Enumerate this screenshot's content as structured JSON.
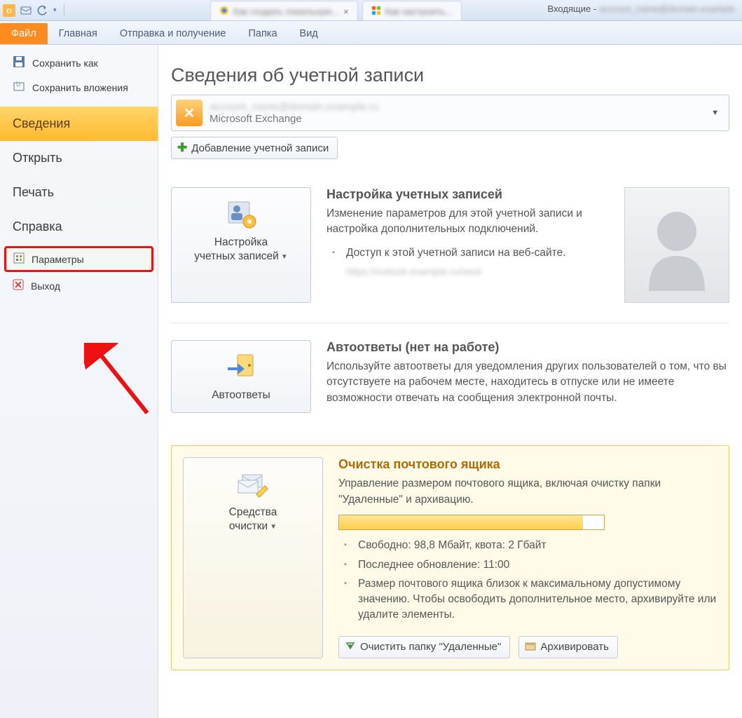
{
  "titlebar": {
    "title_prefix": "Входящие - ",
    "browser_tab1": "Как создать локальную...",
    "browser_tab2": "Как настроить..."
  },
  "ribbon": {
    "file": "Файл",
    "home": "Главная",
    "sendreceive": "Отправка и получение",
    "folder": "Папка",
    "view": "Вид"
  },
  "backstage": {
    "saveas": "Сохранить как",
    "saveattach": "Сохранить вложения",
    "info": "Сведения",
    "open": "Открыть",
    "print": "Печать",
    "help": "Справка",
    "options": "Параметры",
    "exit": "Выход"
  },
  "account": {
    "heading": "Сведения об учетной записи",
    "email_blurred": "account_name@domain.example.ru",
    "type": "Microsoft Exchange",
    "add_btn": "Добавление учетной записи"
  },
  "sec1": {
    "btn_line1": "Настройка",
    "btn_line2": "учетных записей",
    "title": "Настройка учетных записей",
    "desc": "Изменение параметров для этой учетной записи и настройка дополнительных подключений.",
    "bullet1": "Доступ к этой учетной записи на веб-сайте.",
    "url_blurred": "https://outlook.example.ru/owa/"
  },
  "sec2": {
    "btn": "Автоответы",
    "title": "Автоответы (нет на работе)",
    "desc": "Используйте автоответы для уведомления других пользователей о том, что вы отсутствуете на рабочем месте, находитесь в отпуске или не имеете возможности отвечать на сообщения электронной почты."
  },
  "sec3": {
    "btn_line1": "Средства",
    "btn_line2": "очистки",
    "title": "Очистка почтового ящика",
    "desc": "Управление размером почтового ящика, включая очистку папки \"Удаленные\" и архивацию.",
    "b1": "Свободно: 98,8 Мбайт, квота: 2 Гбайт",
    "b2": "Последнее обновление: 11:00",
    "b3": "Размер почтового ящика близок к максимальному допустимому значению. Чтобы освободить дополнительное место, архивируйте или удалите элементы.",
    "empty_btn": "Очистить папку \"Удаленные\"",
    "archive_btn": "Архивировать"
  }
}
